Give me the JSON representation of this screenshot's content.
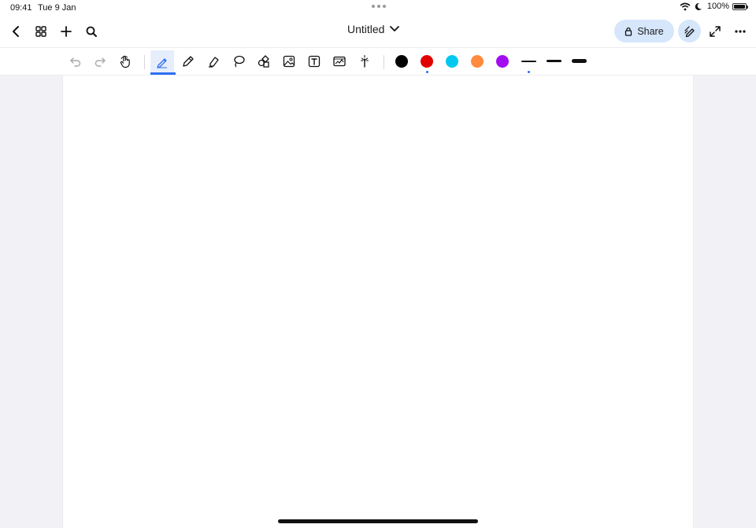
{
  "status": {
    "time": "09:41",
    "date": "Tue 9 Jan",
    "battery": "100%"
  },
  "nav": {
    "title": "Untitled",
    "share_label": "Share"
  },
  "toolbar": {
    "colors": [
      "#000000",
      "#e00000",
      "#00c8f0",
      "#ff8a3d",
      "#a30cf0"
    ],
    "selected_color_index": 1,
    "selected_stroke_index": 0,
    "active_tool": "pen"
  }
}
